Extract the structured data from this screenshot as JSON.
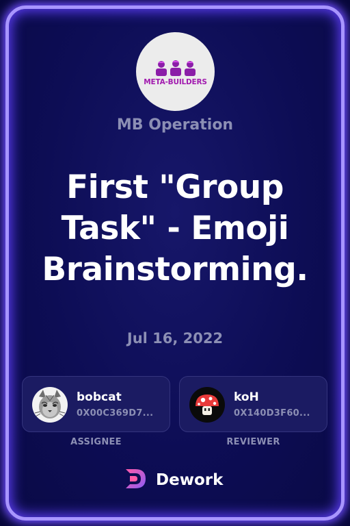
{
  "org": {
    "logo_text": "META-BUILDERS",
    "name": "MB Operation"
  },
  "task": {
    "title": "First \"Group Task\" - Emoji Brainstorming.",
    "date": "Jul 16, 2022"
  },
  "assignee": {
    "name": "bobcat",
    "address": "0X00C369D7...",
    "role": "ASSIGNEE"
  },
  "reviewer": {
    "name": "koH",
    "address": "0X140D3F60...",
    "role": "REVIEWER"
  },
  "brand": {
    "name": "Dework"
  },
  "colors": {
    "accent_border": "#a895ff",
    "background": "#0d0d55",
    "muted_text": "#8c8fb4",
    "logo_purple": "#a21caf"
  }
}
